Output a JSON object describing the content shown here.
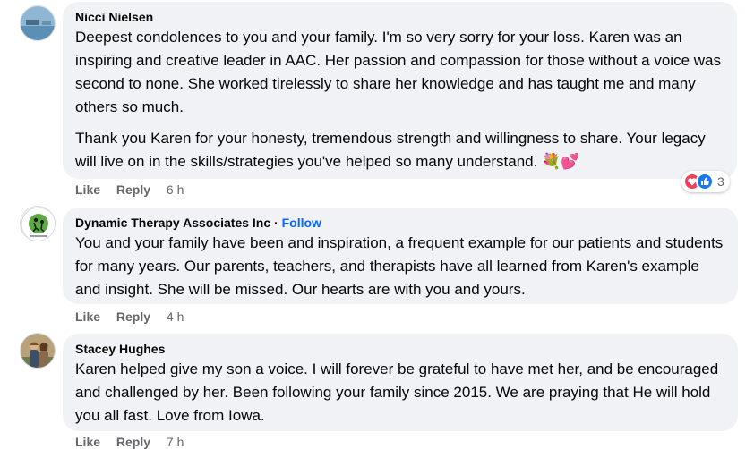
{
  "comments": [
    {
      "author": "Nicci Nielsen",
      "paragraphs": [
        "Deepest condolences to you and your family. I'm so very sorry for your loss. Karen was an inspiring and creative leader in AAC. Her passion and compassion for those without a voice was second to none. She worked tirelessly to share her knowledge and has taught me and many others so much.",
        "Thank you Karen for your honesty, tremendous strength and willingness to share. Your legacy will live on in the skills/strategies you've helped so many understand."
      ],
      "like_label": "Like",
      "reply_label": "Reply",
      "time": "6 h",
      "reaction_count": "3"
    },
    {
      "author": "Dynamic Therapy Associates Inc",
      "separator": "·",
      "follow_label": "Follow",
      "paragraphs": [
        "You and your family have been and inspiration, a frequent example for our patients and students for many years. Our parents, teachers, and therapists have all learned from Karen's example and insight. She will be missed. Our hearts are with you and yours."
      ],
      "like_label": "Like",
      "reply_label": "Reply",
      "time": "4 h"
    },
    {
      "author": "Stacey Hughes",
      "paragraphs": [
        "Karen helped give my son a voice. I will forever be grateful to have met her, and be encouraged and challenged by her. Been following your family since 2015. We are praying that He will hold you all fast. Love from Iowa."
      ],
      "like_label": "Like",
      "reply_label": "Reply",
      "time": "7 h"
    }
  ],
  "colors": {
    "bubble": "#f0f2f5",
    "meta": "#65676b",
    "link": "#0866ff"
  },
  "icons": [
    "bouquet-emoji",
    "hearts-emoji",
    "love-reaction-icon",
    "like-reaction-icon"
  ]
}
